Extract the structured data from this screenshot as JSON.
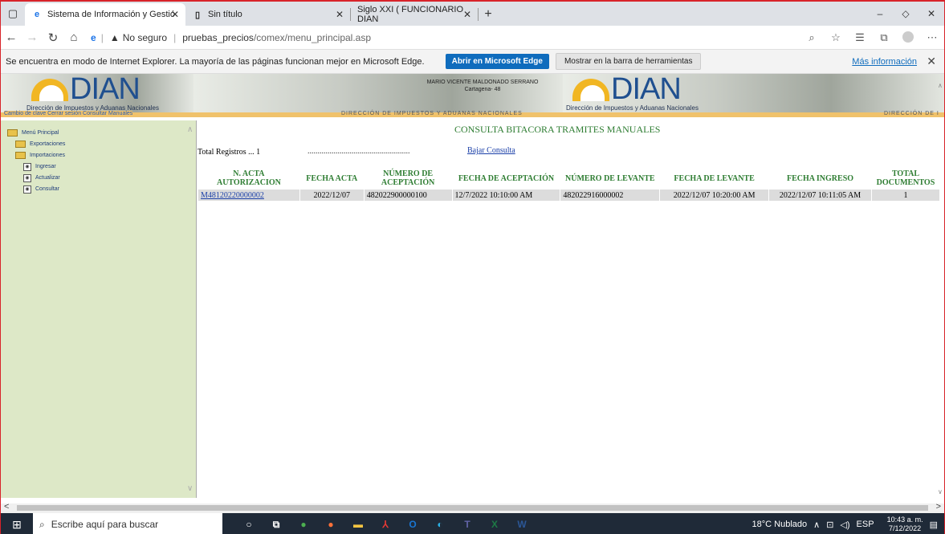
{
  "browser": {
    "tabs": [
      {
        "title": "Sistema de Información y Gestió",
        "icon": "ie-icon",
        "active": true
      },
      {
        "title": "Sin título",
        "icon": "page-icon",
        "active": false
      },
      {
        "title": "Siglo XXI ( FUNCIONARIO DIAN",
        "icon": "",
        "active": false
      }
    ],
    "new_tab": "+",
    "address": {
      "security": "No seguro",
      "host": "pruebas_precios",
      "path": "/comex/menu_principal.asp"
    }
  },
  "ie_bar": {
    "message": "Se encuentra en modo de Internet Explorer. La mayoría de las páginas funcionan mejor en Microsoft Edge.",
    "open_edge": "Abrir en Microsoft Edge",
    "show_toolbar": "Mostrar en la barra de herramientas",
    "more_info": "Más información"
  },
  "header": {
    "logo_text": "DIAN",
    "logo_sub": "Dirección de Impuestos y Aduanas Nacionales",
    "links": "Cambio de clave  Cerrar sesión  Consultar Manuales",
    "user_line1": "MARIO VICENTE MALDONADO SERRANO",
    "user_line2": "Cartagena- 48",
    "watermark": "DIRECCIÓN DE IMPUESTOS Y ADUANAS NACIONALES",
    "watermark_short": "DIRECCIÓN DE I"
  },
  "sidebar": {
    "root": "Menú Principal",
    "items": [
      {
        "label": "Exportaciones",
        "level": 1
      },
      {
        "label": "Importaciones",
        "level": 1
      },
      {
        "label": "Ingresar",
        "level": 2
      },
      {
        "label": "Actualizar",
        "level": 2
      },
      {
        "label": "Consultar",
        "level": 2
      }
    ]
  },
  "main": {
    "title": "CONSULTA BITACORA TRAMITES MANUALES",
    "total": "Total Registros ... 1",
    "dots": "...................................................",
    "download": "Bajar Consulta",
    "columns": [
      "N. ACTA AUTORIZACION",
      "FECHA ACTA",
      "NÚMERO DE ACEPTACIÓN",
      "FECHA DE ACEPTACIÓN",
      "NÚMERO DE LEVANTE",
      "FECHA DE LEVANTE",
      "FECHA INGRESO",
      "TOTAL DOCUMENTOS"
    ],
    "rows": [
      [
        "M48120220000002",
        "2022/12/07",
        "482022900000100",
        "12/7/2022 10:10:00 AM",
        "482022916000002",
        "2022/12/07 10:20:00 AM",
        "2022/12/07 10:11:05 AM",
        "1"
      ]
    ]
  },
  "taskbar": {
    "search_placeholder": "Escribe aquí para buscar",
    "weather": "18°C  Nublado",
    "lang": "ESP",
    "time": "10:43 a. m.",
    "date": "7/12/2022"
  }
}
